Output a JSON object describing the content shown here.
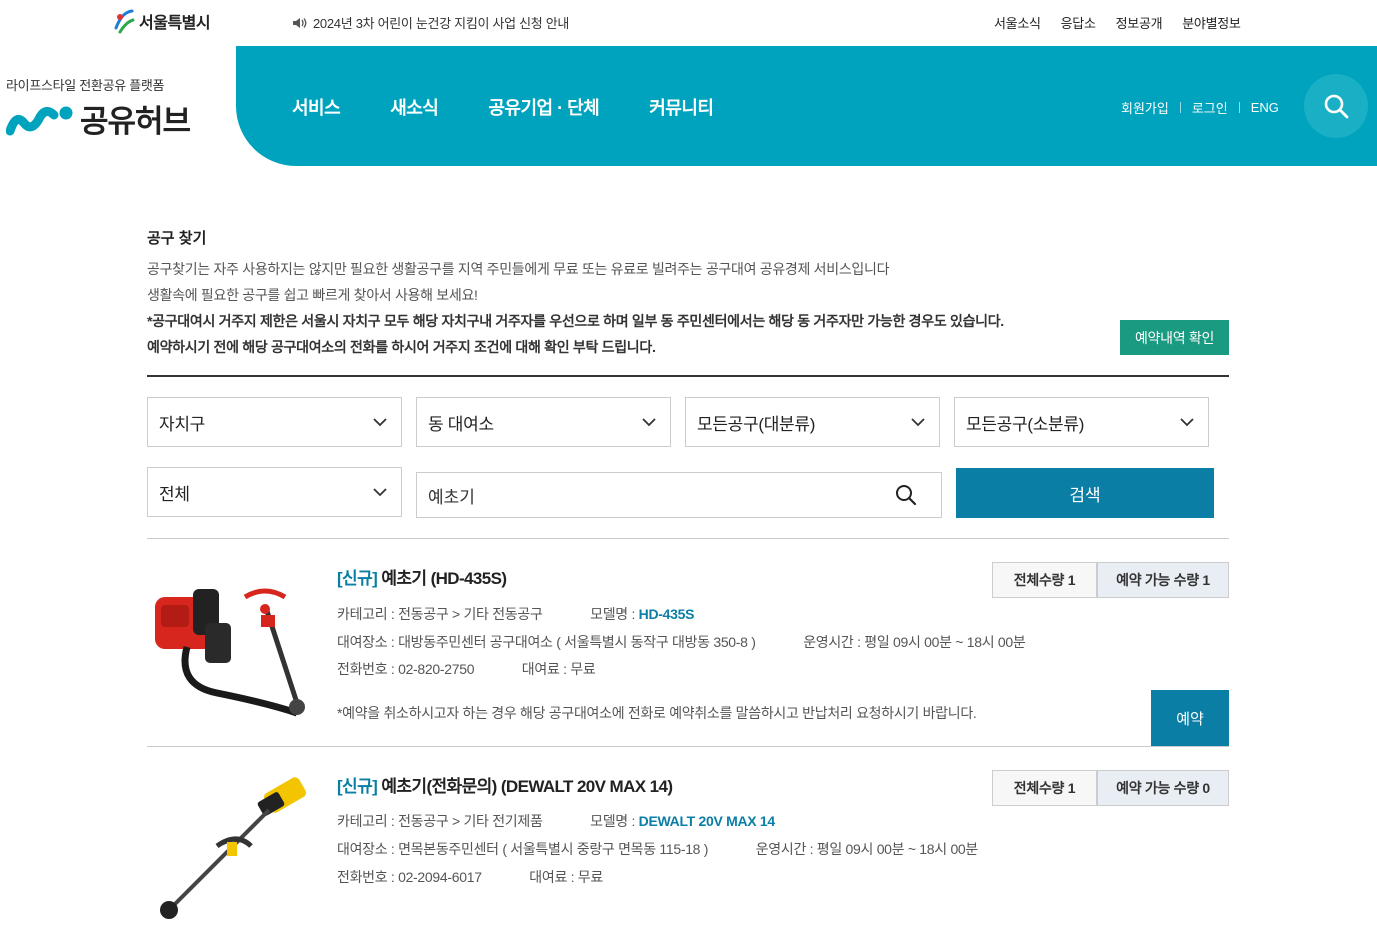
{
  "header": {
    "city_logo": "서울특별시",
    "notice": "2024년 3차 어린이 눈건강 지킴이 사업 신청 안내",
    "util_links": [
      "서울소식",
      "응답소",
      "정보공개",
      "분야별정보"
    ],
    "brand_sub": "라이프스타일 전환공유 플랫폼",
    "brand": "공유허브",
    "nav": [
      "서비스",
      "새소식",
      "공유기업 · 단체",
      "커뮤니티"
    ],
    "user_links": [
      "회원가입",
      "로그인",
      "ENG"
    ]
  },
  "intro": {
    "title": "공구 찾기",
    "line1": "공구찾기는 자주 사용하지는 않지만 필요한 생활공구를 지역 주민들에게 무료 또는 유료로 빌려주는 공구대여 공유경제 서비스입니다",
    "line2": "생활속에 필요한 공구를 쉽고 빠르게 찾아서 사용해 보세요!",
    "line3": "*공구대여시 거주지 제한은 서울시 자치구 모두 해당 자치구내 거주자를 우선으로 하며 일부 동 주민센터에서는 해당 동 거주자만 가능한 경우도 있습니다.",
    "line4": "예약하시기 전에 해당 공구대여소의 전화를 하시어 거주지 조건에 대해 확인 부탁 드립니다.",
    "reservation_button": "예약내역 확인"
  },
  "filters": {
    "district": "자치구",
    "rental_office": "동 대여소",
    "major_category": "모든공구(대분류)",
    "minor_category": "모든공구(소분류)",
    "scope": "전체",
    "keyword": "예초기",
    "search_button": "검색"
  },
  "results": [
    {
      "badge": "[신규]",
      "name": "예초기 (HD-435S)",
      "category": "카테고리 : 전동공구 > 기타 전동공구",
      "model_label": "모델명 : ",
      "model": "HD-435S",
      "place": "대여장소 : 대방동주민센터 공구대여소 ( 서울특별시 동작구 대방동 350-8 )",
      "hours": "운영시간 : 평일 09시 00분 ~ 18시 00분",
      "phone": "전화번호 : 02-820-2750",
      "fee": "대여료 : 무료",
      "note": "*예약을 취소하시고자 하는 경우 해당 공구대여소에 전화로 예약취소를 말씀하시고 반납처리 요청하시기 바랍니다.",
      "total_qty": "전체수량 1",
      "avail_qty": "예약 가능 수량 1",
      "book_button": "예약"
    },
    {
      "badge": "[신규]",
      "name": "예초기(전화문의) (DEWALT 20V MAX 14)",
      "category": "카테고리 : 전동공구 > 기타 전기제품",
      "model_label": "모델명 : ",
      "model": "DEWALT 20V MAX 14",
      "place": "대여장소 : 면목본동주민센터 ( 서울특별시 중랑구 면목동 115-18 )",
      "hours": "운영시간 : 평일 09시 00분 ~ 18시 00분",
      "phone": "전화번호 : 02-2094-6017",
      "fee": "대여료 : 무료",
      "total_qty": "전체수량 1",
      "avail_qty": "예약 가능 수량 0"
    }
  ],
  "colors": {
    "nav_teal": "#00a3bd",
    "primary_blue": "#0a7ea4",
    "green_button": "#1b9a82"
  }
}
